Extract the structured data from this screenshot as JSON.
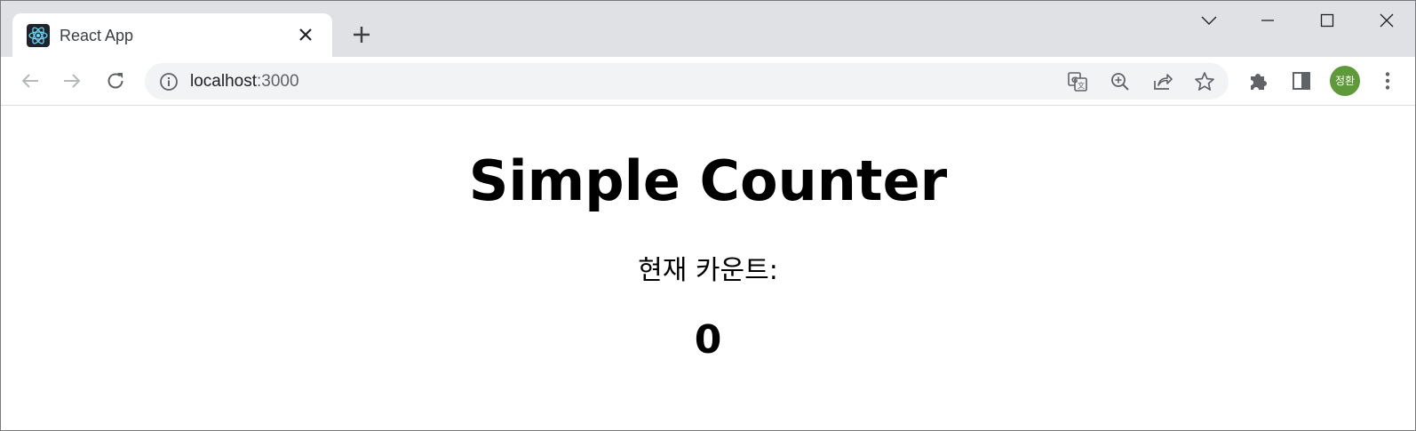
{
  "browser": {
    "tab": {
      "title": "React App",
      "favicon": "react-logo-icon"
    },
    "new_tab_icon": "plus-icon",
    "window_controls": [
      "chevron-down-icon",
      "minimize-icon",
      "maximize-icon",
      "close-icon"
    ],
    "nav": [
      "back-arrow-icon",
      "forward-arrow-icon",
      "reload-icon"
    ],
    "address": {
      "host": "localhost",
      "port": ":3000",
      "info_icon": "info-icon"
    },
    "omnibox_actions": [
      "translate-icon",
      "zoom-icon",
      "share-icon",
      "bookmark-star-icon"
    ],
    "toolbar_actions": [
      "extensions-puzzle-icon",
      "side-panel-icon",
      "kebab-menu-icon"
    ],
    "profile": {
      "initials": "정환",
      "color": "#5f9a3a"
    }
  },
  "page": {
    "title": "Simple Counter",
    "count_label": "현재 카운트:",
    "count_value": "0"
  }
}
